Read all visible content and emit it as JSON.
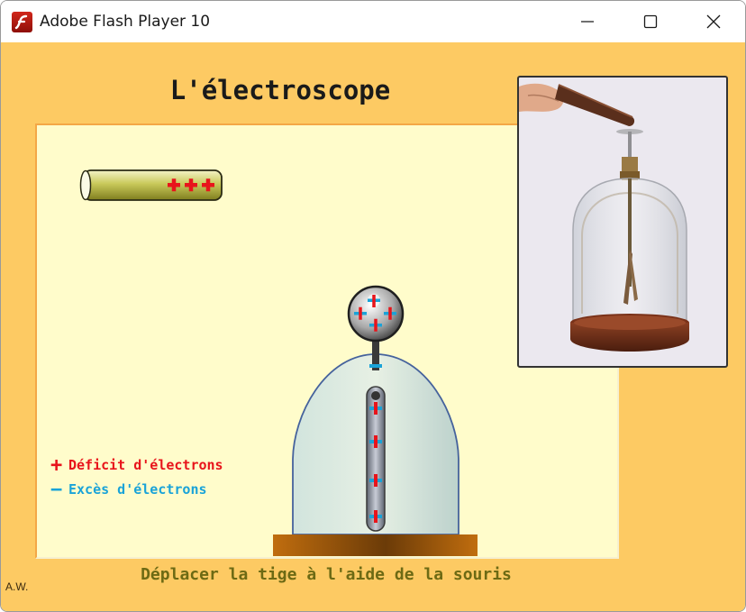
{
  "window": {
    "title": "Adobe Flash Player 10",
    "app_icon": "flash-player-icon",
    "controls": [
      "minimize-icon",
      "maximize-icon",
      "close-icon"
    ]
  },
  "content": {
    "title": "L'électroscope",
    "instruction": "Déplacer la tige à l'aide de la souris",
    "author": "A.W.",
    "legend": {
      "deficit_symbol": "+",
      "deficit_label": "Déficit d'électrons",
      "exces_symbol": "−",
      "exces_label": "Excès d'électrons"
    },
    "rod_charges": "+++",
    "colors": {
      "background": "#fdca63",
      "panel": "#fffccb",
      "positive": "#e8141b",
      "negative": "#1aa3d8"
    }
  }
}
